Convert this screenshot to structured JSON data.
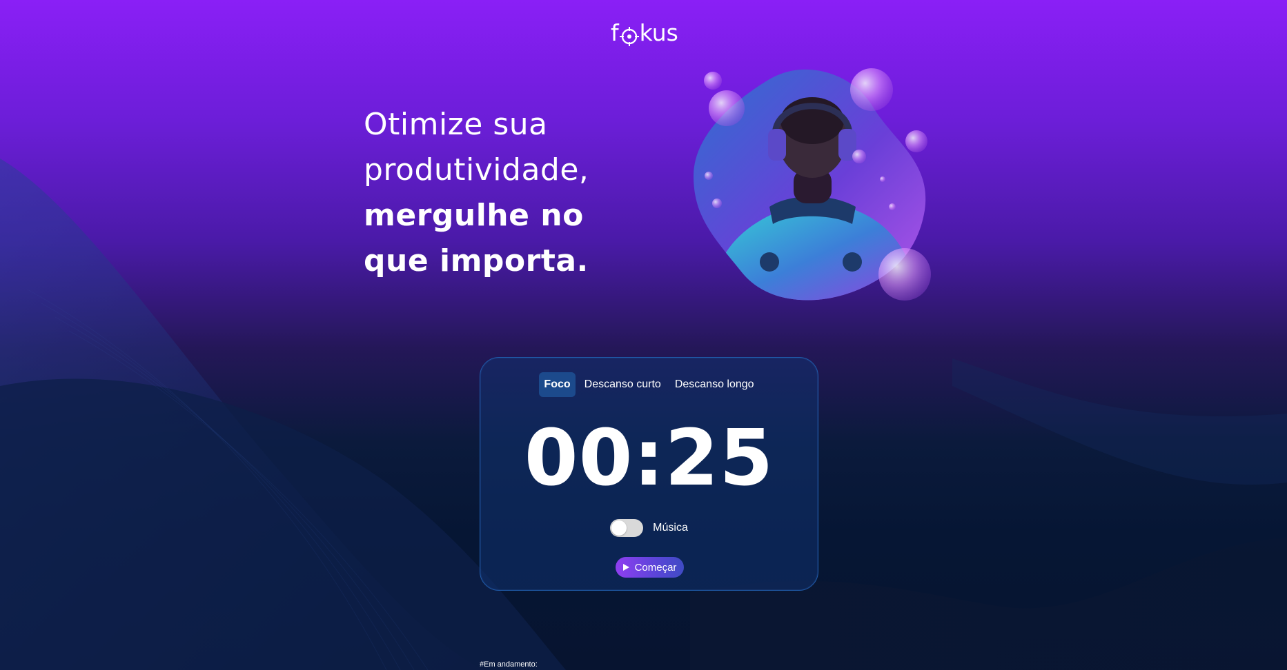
{
  "logo": {
    "letter_f": "f",
    "letters_rest": "kus",
    "icon": "target-o-icon"
  },
  "hero": {
    "line1": "Otimize sua",
    "line2": "produtividade,",
    "line3": "mergulhe no",
    "line4": "que importa.",
    "image": "man-with-headphones-and-bubbles-illustration"
  },
  "timer_card": {
    "tabs": [
      {
        "label": "Foco",
        "active": true
      },
      {
        "label": "Descanso curto",
        "active": false
      },
      {
        "label": "Descanso longo",
        "active": false
      }
    ],
    "time": "00:25",
    "music": {
      "label": "Música",
      "enabled": false
    },
    "start_button": {
      "label": "Começar",
      "icon": "play-icon"
    }
  },
  "footer": {
    "status": "#Em andamento:"
  },
  "colors": {
    "bg_top": "#8a1ff6",
    "bg_bottom": "#061634",
    "card_border": "#1f5aa8",
    "tab_active_bg": "#1c4a8c",
    "button_gradient_start": "#8f3ff0",
    "button_gradient_end": "#3f4bc4"
  }
}
